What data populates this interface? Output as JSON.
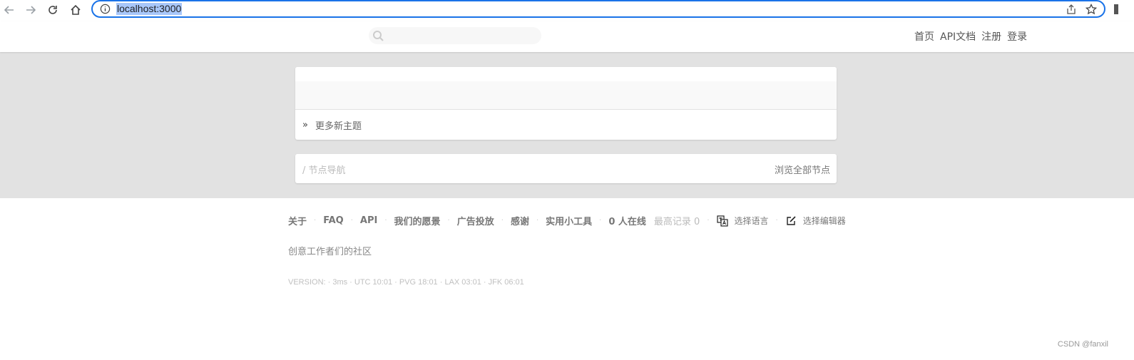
{
  "browser": {
    "url": "localhost:3000",
    "accent": "#1a73e8"
  },
  "header": {
    "search_placeholder": "",
    "nav": [
      "首页",
      "API文档",
      "注册",
      "登录"
    ]
  },
  "main": {
    "more_topics_arrow": "»",
    "more_topics": "更多新主题",
    "nodes_title": "/ 节点导航",
    "browse_all_nodes": "浏览全部节点"
  },
  "footer": {
    "about": "关于",
    "faq": "FAQ",
    "api": "API",
    "mission": "我们的愿景",
    "ads": "广告投放",
    "thanks": "感谢",
    "tools": "实用小工具",
    "online": "0 人在线",
    "record": "最高记录 0",
    "language": "选择语言",
    "editor": "选择编辑器",
    "tagline": "创意工作者们的社区",
    "version": "VERSION: · 3ms · UTC 10:01 · PVG 18:01 · LAX 03:01 · JFK 06:01"
  },
  "watermark": "CSDN @fanxil"
}
